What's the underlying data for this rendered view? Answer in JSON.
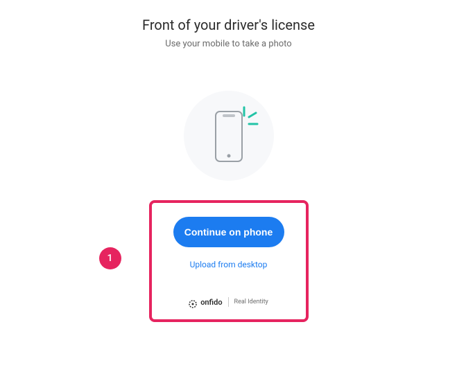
{
  "header": {
    "title": "Front of your driver's license",
    "subtitle": "Use your mobile to take a photo"
  },
  "actions": {
    "primary_label": "Continue on phone",
    "secondary_label": "Upload from desktop"
  },
  "branding": {
    "name": "onfido",
    "tagline": "Real Identity"
  },
  "annotation": {
    "number": "1"
  },
  "colors": {
    "accent": "#1c7cf0",
    "highlight": "#e6245f"
  }
}
